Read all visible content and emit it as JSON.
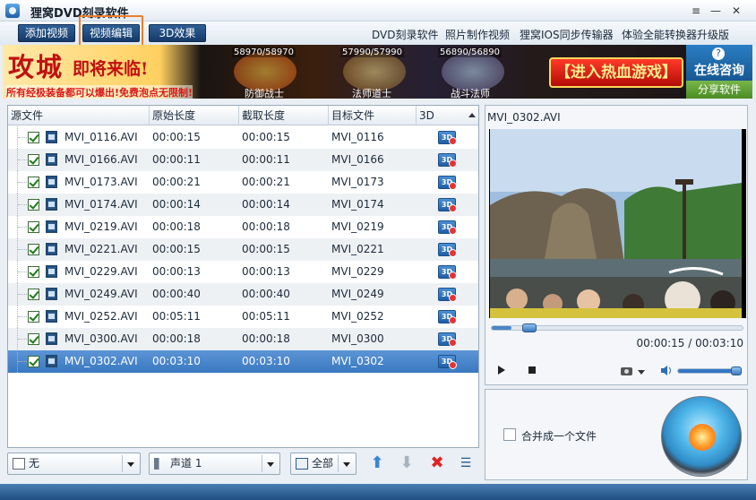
{
  "app": {
    "title": "狸窝DVD刻录软件",
    "controls": {
      "menu": "≡",
      "minimize": "—",
      "close": "✕"
    }
  },
  "toolbar": {
    "add_video": "添加视频",
    "video_edit": "视频编辑",
    "effect_3d": "3D效果",
    "links": [
      "DVD刻录软件",
      "照片制作视频",
      "狸窝IOS同步传输器",
      "体验全能转换器升级版"
    ]
  },
  "banner": {
    "slogan_big": "攻城",
    "slogan_small": "即将来临!",
    "subtitle": "所有经极装备都可以爆出!免费泡点无限制!",
    "scores": [
      "58970/58970",
      "57990/57990",
      "56890/56890"
    ],
    "names": [
      "防御战士",
      "法师道士",
      "战斗法师"
    ],
    "cta": "【进入热血游戏】",
    "consult": "在线咨询",
    "share": "分享软件",
    "colors": {
      "cta": "#d81b1b",
      "consult": "#1f6fb0",
      "share": "#5a9e2f"
    }
  },
  "table": {
    "headers": [
      "源文件",
      "原始长度",
      "截取长度",
      "目标文件",
      "3D"
    ],
    "rows": [
      {
        "source": "MVI_0116.AVI",
        "original": "00:00:15",
        "clip": "00:00:15",
        "target": "MVI_0116",
        "checked": true
      },
      {
        "source": "MVI_0166.AVI",
        "original": "00:00:11",
        "clip": "00:00:11",
        "target": "MVI_0166",
        "checked": true
      },
      {
        "source": "MVI_0173.AVI",
        "original": "00:00:21",
        "clip": "00:00:21",
        "target": "MVI_0173",
        "checked": true
      },
      {
        "source": "MVI_0174.AVI",
        "original": "00:00:14",
        "clip": "00:00:14",
        "target": "MVI_0174",
        "checked": true
      },
      {
        "source": "MVI_0219.AVI",
        "original": "00:00:18",
        "clip": "00:00:18",
        "target": "MVI_0219",
        "checked": true
      },
      {
        "source": "MVI_0221.AVI",
        "original": "00:00:15",
        "clip": "00:00:15",
        "target": "MVI_0221",
        "checked": true
      },
      {
        "source": "MVI_0229.AVI",
        "original": "00:00:13",
        "clip": "00:00:13",
        "target": "MVI_0229",
        "checked": true
      },
      {
        "source": "MVI_0249.AVI",
        "original": "00:00:40",
        "clip": "00:00:40",
        "target": "MVI_0249",
        "checked": true
      },
      {
        "source": "MVI_0252.AVI",
        "original": "00:05:11",
        "clip": "00:05:11",
        "target": "MVI_0252",
        "checked": true
      },
      {
        "source": "MVI_0300.AVI",
        "original": "00:00:18",
        "clip": "00:00:18",
        "target": "MVI_0300",
        "checked": true
      },
      {
        "source": "MVI_0302.AVI",
        "original": "00:03:10",
        "clip": "00:03:10",
        "target": "MVI_0302",
        "checked": true,
        "selected": true
      }
    ],
    "badge_3d": "3D"
  },
  "bottombar": {
    "subtitle_value": "无",
    "audio_value": "声道 1",
    "scope_value": "全部",
    "icons": [
      "subtitle-icon",
      "speaker-icon",
      "edit-icon",
      "up-arrow-icon",
      "down-arrow-icon",
      "delete-icon",
      "clear-list-icon"
    ]
  },
  "preview": {
    "filename": "MVI_0302.AVI",
    "time": "00:00:15 / 00:03:10",
    "seek_fraction": 0.08,
    "volume_fraction": 0.95
  },
  "burn": {
    "merge_label": "合并成一个文件",
    "merge_checked": false
  }
}
